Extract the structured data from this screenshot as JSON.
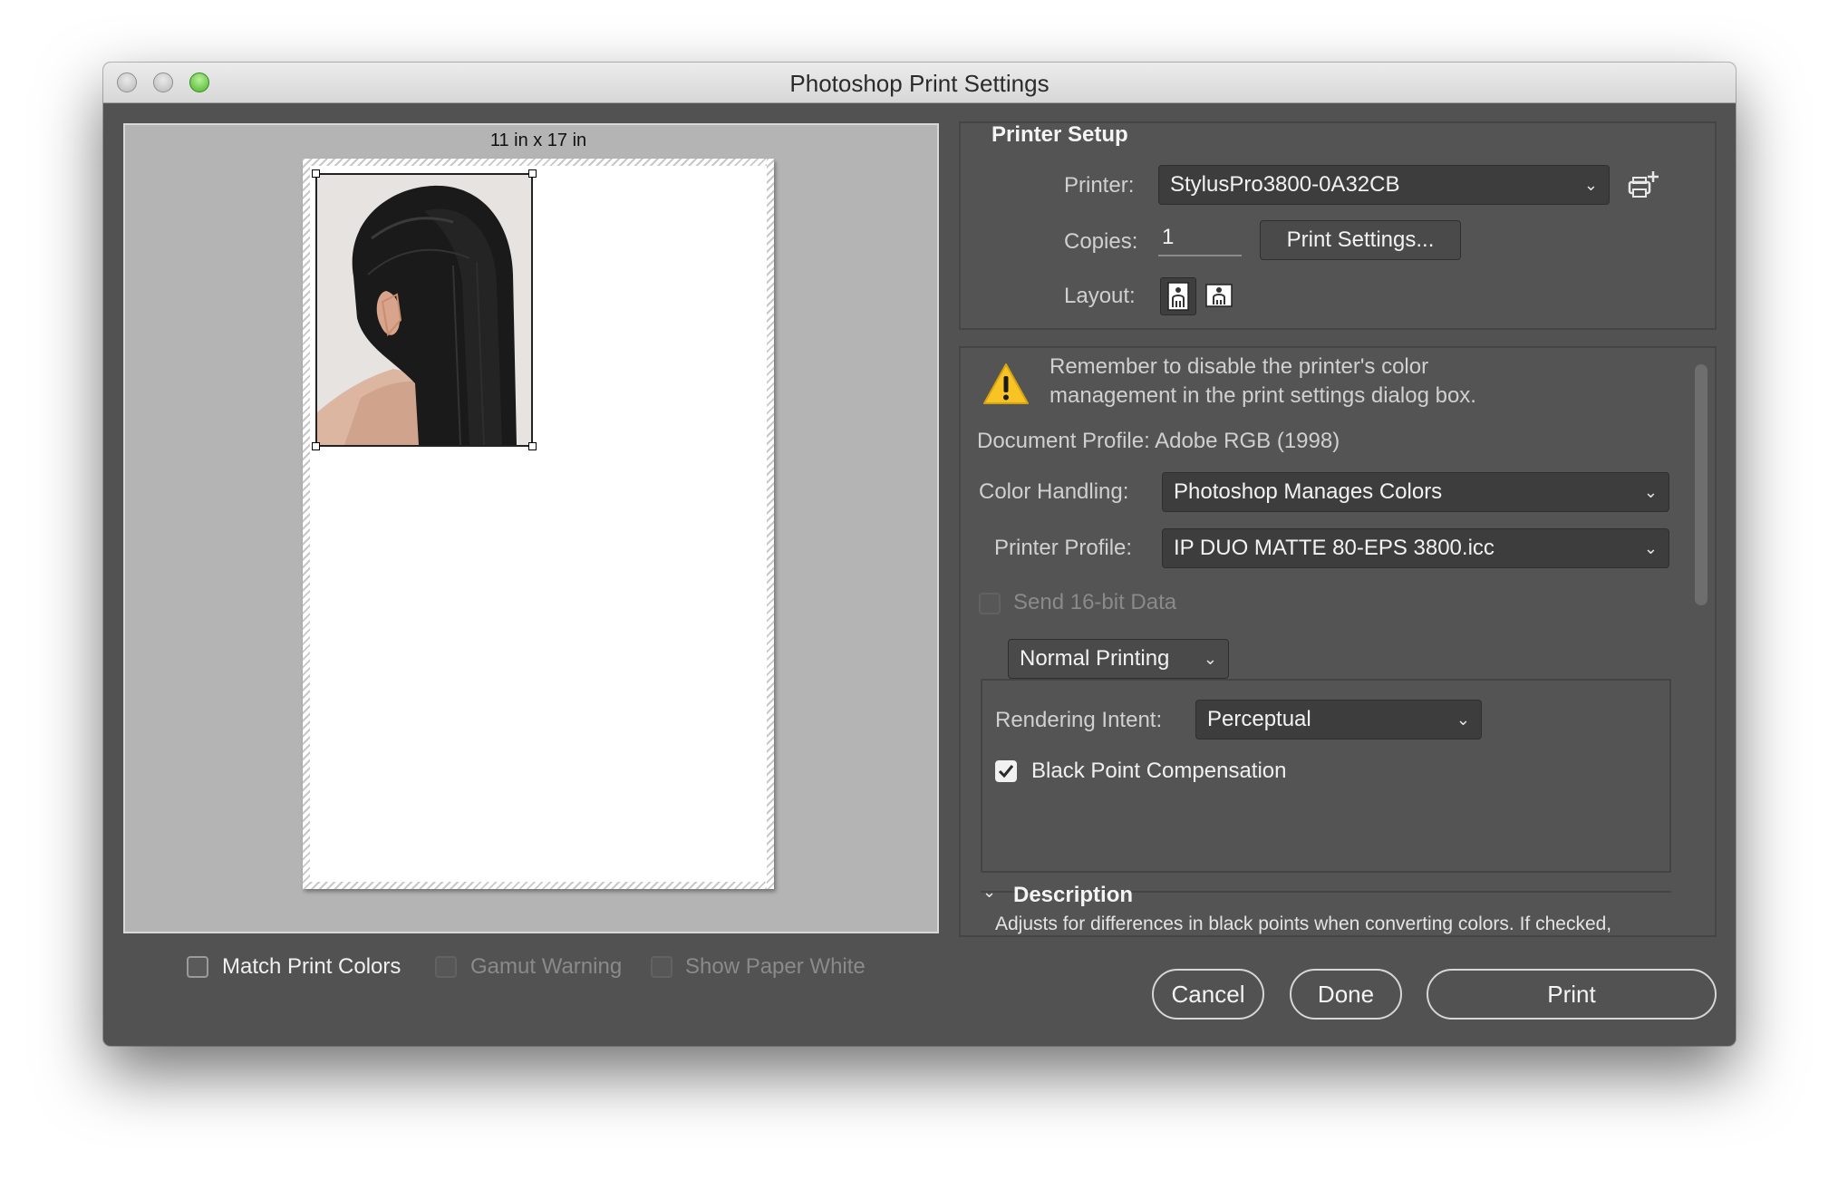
{
  "window": {
    "title": "Photoshop Print Settings"
  },
  "preview": {
    "paper_size": "11 in x 17 in"
  },
  "preview_options": [
    {
      "label": "Match Print Colors",
      "checked": false,
      "enabled": true
    },
    {
      "label": "Gamut Warning",
      "checked": false,
      "enabled": false
    },
    {
      "label": "Show Paper White",
      "checked": false,
      "enabled": false
    }
  ],
  "printer_setup": {
    "title": "Printer Setup",
    "printer_label": "Printer:",
    "printer_value": "StylusPro3800-0A32CB",
    "copies_label": "Copies:",
    "copies_value": "1",
    "print_settings_button": "Print Settings...",
    "layout_label": "Layout:",
    "layout_options": [
      "portrait",
      "landscape"
    ],
    "layout_selected": "portrait"
  },
  "color_management": {
    "warning": [
      "Remember to disable the printer's color",
      "management in the print settings dialog box."
    ],
    "document_profile": "Document Profile: Adobe RGB (1998)",
    "color_handling_label": "Color Handling:",
    "color_handling_value": "Photoshop Manages Colors",
    "printer_profile_label": "Printer Profile:",
    "printer_profile_value": "IP DUO MATTE 80-EPS 3800.icc",
    "send_16bit_label": "Send 16-bit Data",
    "send_16bit_checked": false,
    "send_16bit_enabled": false,
    "printing_mode": "Normal Printing",
    "rendering_intent_label": "Rendering Intent:",
    "rendering_intent_value": "Perceptual",
    "bpc_label": "Black Point Compensation",
    "bpc_checked": true
  },
  "description": {
    "title": "Description",
    "text": "Adjusts for differences in black points when converting colors. If checked,"
  },
  "buttons": {
    "cancel": "Cancel",
    "done": "Done",
    "print": "Print"
  },
  "colors": {
    "window_bg": "#525252",
    "preview_bg": "#b4b4b4",
    "select_bg": "#3d3d3d",
    "warning_yellow": "#f7c325"
  }
}
